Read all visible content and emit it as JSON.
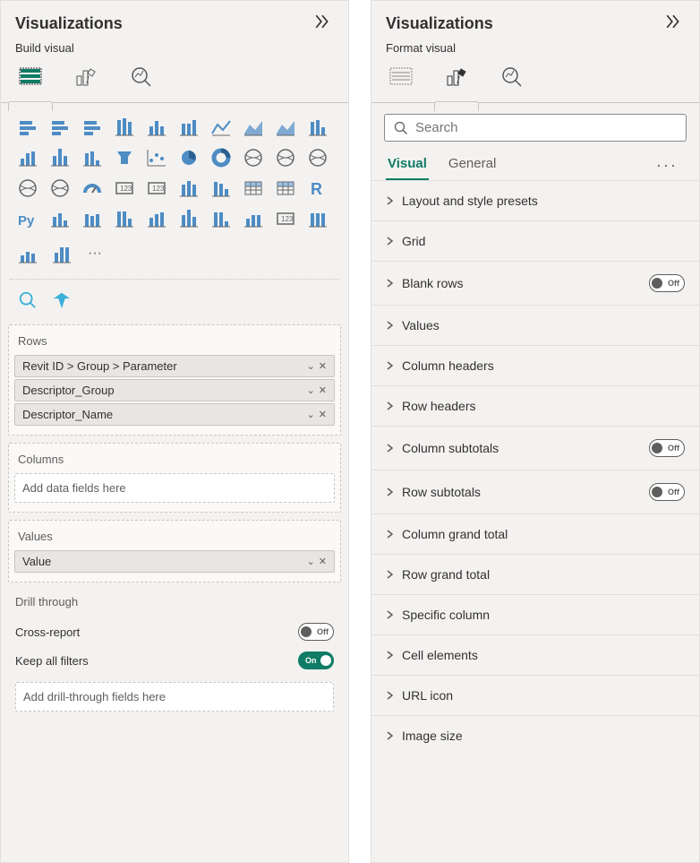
{
  "left": {
    "title": "Visualizations",
    "subtitle": "Build visual",
    "modeTabs": [
      "build",
      "format",
      "analytics"
    ],
    "activeModeTab": 0,
    "rows": {
      "label": "Rows",
      "fields": [
        "Revit ID > Group > Parameter",
        "Descriptor_Group",
        "Descriptor_Name"
      ]
    },
    "columns": {
      "label": "Columns",
      "placeholder": "Add data fields here"
    },
    "values": {
      "label": "Values",
      "fields": [
        "Value"
      ]
    },
    "drill": {
      "title": "Drill through",
      "crossReport": {
        "label": "Cross-report",
        "state": "Off"
      },
      "keepFilters": {
        "label": "Keep all filters",
        "state": "On"
      },
      "placeholder": "Add drill-through fields here"
    }
  },
  "right": {
    "title": "Visualizations",
    "subtitle": "Format visual",
    "modeTabs": [
      "build",
      "format",
      "analytics"
    ],
    "activeModeTab": 1,
    "searchPlaceholder": "Search",
    "formatTabs": {
      "visual": "Visual",
      "general": "General",
      "active": "visual"
    },
    "items": [
      {
        "label": "Layout and style presets",
        "toggle": null
      },
      {
        "label": "Grid",
        "toggle": null
      },
      {
        "label": "Blank rows",
        "toggle": "Off"
      },
      {
        "label": "Values",
        "toggle": null
      },
      {
        "label": "Column headers",
        "toggle": null
      },
      {
        "label": "Row headers",
        "toggle": null
      },
      {
        "label": "Column subtotals",
        "toggle": "Off"
      },
      {
        "label": "Row subtotals",
        "toggle": "Off"
      },
      {
        "label": "Column grand total",
        "toggle": null
      },
      {
        "label": "Row grand total",
        "toggle": null
      },
      {
        "label": "Specific column",
        "toggle": null
      },
      {
        "label": "Cell elements",
        "toggle": null
      },
      {
        "label": "URL icon",
        "toggle": null
      },
      {
        "label": "Image size",
        "toggle": null
      }
    ]
  },
  "vizIcons": [
    "stacked-bar",
    "clustered-bar",
    "stacked-bar-100",
    "clustered-column",
    "stacked-column",
    "stacked-column-100",
    "line",
    "area",
    "stacked-area",
    "ribbon",
    "line-column",
    "line-column-stacked",
    "waterfall",
    "funnel",
    "scatter",
    "pie",
    "donut",
    "treemap",
    "map",
    "filled-map",
    "shape-map",
    "azure-map",
    "gauge",
    "card",
    "multi-card",
    "kpi",
    "slicer",
    "table",
    "matrix",
    "r-visual",
    "python-visual",
    "key-influencers",
    "decomposition",
    "qa",
    "smart-narrative",
    "paginated",
    "metrics",
    "app",
    "scorecard",
    "get-more",
    "narrative-2",
    "arcgis",
    "more-ellipsis"
  ]
}
